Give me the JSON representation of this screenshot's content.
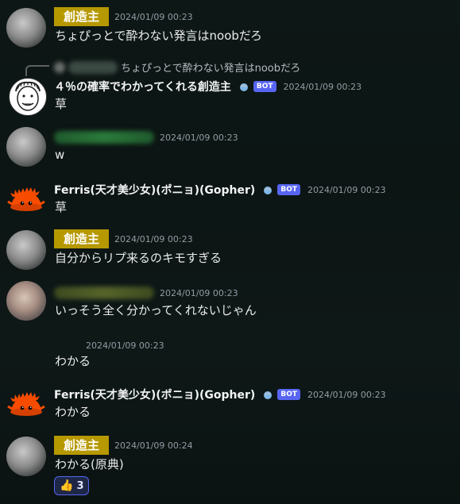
{
  "messages": [
    {
      "role_badge": "創造主",
      "timestamp": "2024/01/09 00:23",
      "text": "ちょぴっとで酔わない発言はnoobだろ"
    },
    {
      "reply_preview": "ちょぴっとで酔わない発言はnoobだろ",
      "author": "４％の確率でわかってくれる創造主",
      "bot_label": "BOT",
      "timestamp": "2024/01/09 00:23",
      "text": "草"
    },
    {
      "timestamp": "2024/01/09 00:23",
      "text": "w"
    },
    {
      "author": "Ferris(天才美少女)(ポニョ)(Gopher)",
      "bot_label": "BOT",
      "timestamp": "2024/01/09 00:23",
      "text": "草"
    },
    {
      "role_badge": "創造主",
      "timestamp": "2024/01/09 00:23",
      "text": "自分からリプ来るのキモすぎる"
    },
    {
      "timestamp": "2024/01/09 00:23",
      "text": "いっそう全く分かってくれないじゃん"
    },
    {
      "timestamp": "2024/01/09 00:23",
      "text": "わかる"
    },
    {
      "author": "Ferris(天才美少女)(ポニョ)(Gopher)",
      "bot_label": "BOT",
      "timestamp": "2024/01/09 00:23",
      "text": "わかる"
    },
    {
      "role_badge": "創造主",
      "timestamp": "2024/01/09 00:24",
      "text": "わかる(原典)",
      "reaction": {
        "emoji": "thumbs-up",
        "glyph": "👍",
        "count": "3"
      }
    }
  ],
  "colors": {
    "role_badge": "#b69800",
    "bot": "#5865f2",
    "crab": "#f74c00",
    "background": "#0d1715"
  }
}
